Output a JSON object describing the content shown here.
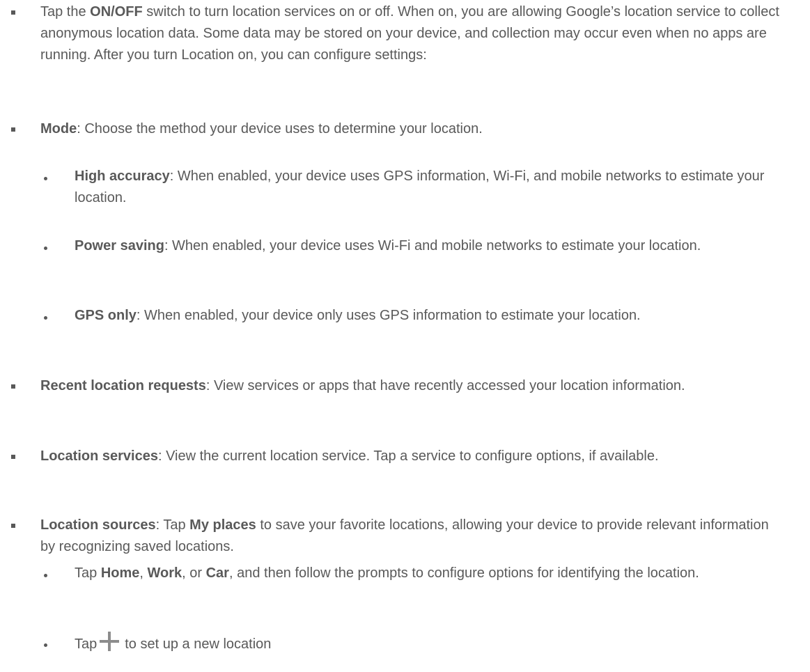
{
  "items": [
    {
      "pre": "Tap the ",
      "b1": "ON/OFF",
      "post": " switch to turn location services on or off. When on, you are allowing Google’s location service to collect anonymous location data. Some data may be stored on your device, and collection may occur even when no apps are running. After you turn Location on, you can configure settings:"
    },
    {
      "b1": "Mode",
      "post": ": Choose the method your device uses to determine your location."
    },
    {
      "b1": "High accuracy",
      "post": ": When enabled, your device uses GPS information, Wi-Fi, and mobile networks to estimate your location."
    },
    {
      "b1": "Power saving",
      "post": ": When enabled, your device uses Wi-Fi and mobile networks to estimate your location."
    },
    {
      "b1": "GPS only",
      "post": ": When enabled, your device only uses GPS information to estimate your location."
    },
    {
      "b1": "Recent location requests",
      "post": ": View services or apps that have recently accessed your location information."
    },
    {
      "b1": "Location services",
      "post": ": View the current location service. Tap a service to configure options, if available."
    },
    {
      "b1": "Location sources",
      "mid1": ": Tap ",
      "b2": "My places",
      "post": " to save your favorite locations, allowing your device to provide relevant information by recognizing saved locations."
    },
    {
      "pre": "Tap ",
      "b1": "Home",
      "mid1": ", ",
      "b2": "Work",
      "mid2": ", or ",
      "b3": "Car",
      "post": ", and then follow the prompts to configure options for identifying the location."
    },
    {
      "pre": "Tap",
      "icon": "plus-icon",
      "post": "to set up a new location"
    }
  ]
}
